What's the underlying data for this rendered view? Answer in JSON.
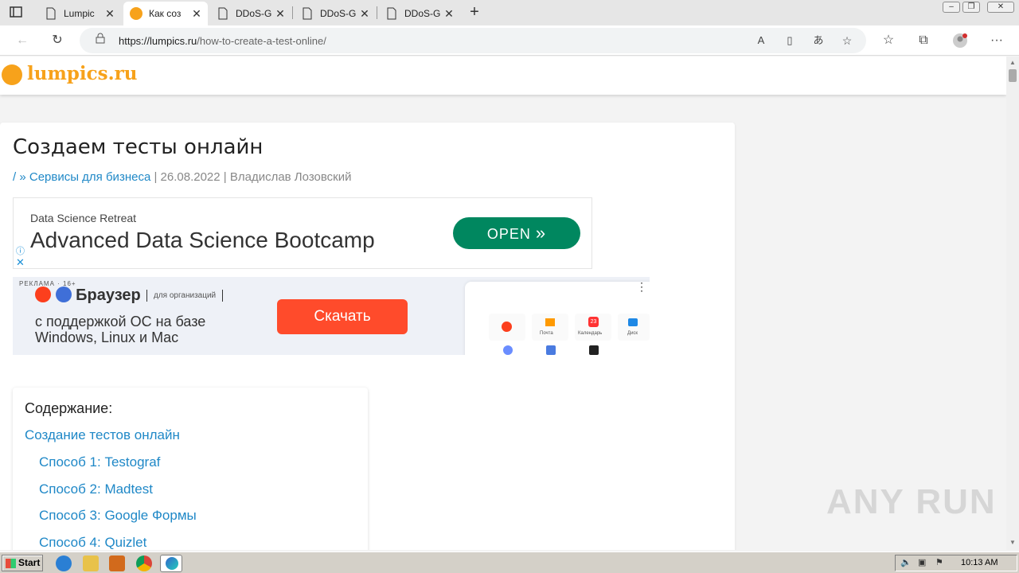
{
  "browser": {
    "tabs": [
      {
        "title": "Lumpic",
        "active": false
      },
      {
        "title": "Как соз",
        "active": true
      },
      {
        "title": "DDoS-G",
        "active": false
      },
      {
        "title": "DDoS-G",
        "active": false
      },
      {
        "title": "DDoS-G",
        "active": false
      }
    ],
    "url_domain": "https://lumpics.ru",
    "url_path": "/how-to-create-a-test-online/"
  },
  "site": {
    "logo_text": "lumpics.ru",
    "brand_color": "#f7a21b"
  },
  "article": {
    "title": "Создаем тесты онлайн",
    "breadcrumb_home": "/",
    "breadcrumb_sep": " » ",
    "category": "Сервисы для бизнеса",
    "date": "26.08.2022",
    "author": "Владислав Лозовский",
    "meta_sep": " | "
  },
  "ad1": {
    "advertiser": "Data Science Retreat",
    "headline": "Advanced Data Science Bootcamp",
    "button": "OPEN",
    "button_color": "#00875f"
  },
  "ad2": {
    "label": "РЕКЛАМА · 16+",
    "brand": "Браузер",
    "org": "для организаций",
    "text": "с поддержкой ОС на базе\nWindows, Linux и Mac",
    "button": "Скачать",
    "button_color": "#ff4b2b",
    "mock_labels": [
      "Почта",
      "Календарь",
      "Диск"
    ],
    "mock_badge": "23"
  },
  "toc": {
    "title": "Содержание:",
    "items": [
      {
        "label": "Создание тестов онлайн",
        "level": 0
      },
      {
        "label": "Способ 1: Testograf",
        "level": 1
      },
      {
        "label": "Способ 2: Madtest",
        "level": 1
      },
      {
        "label": "Способ 3: Google Формы",
        "level": 1
      },
      {
        "label": "Способ 4: Quizlet",
        "level": 1
      }
    ]
  },
  "watermark": "ANY RUN",
  "taskbar": {
    "start": "Start",
    "clock": "10:13 AM"
  },
  "colors": {
    "link": "#1f88c7",
    "tab_strip": "#e6e6e6",
    "taskbar": "#d4d0c8"
  }
}
